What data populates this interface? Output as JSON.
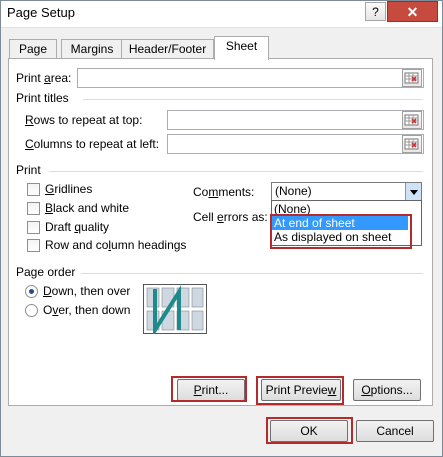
{
  "window": {
    "title": "Page Setup",
    "help": "?",
    "close": "✕"
  },
  "tabs": [
    {
      "label": "Page"
    },
    {
      "label": "Margins"
    },
    {
      "label": "Header/Footer"
    },
    {
      "label": "Sheet"
    }
  ],
  "print_area": {
    "label_pre": "Print ",
    "label_u": "a",
    "label_post": "rea:",
    "value": ""
  },
  "print_titles": {
    "heading": "Print titles",
    "rows": {
      "label_u": "R",
      "label_post": "ows to repeat at top:",
      "value": ""
    },
    "cols": {
      "label_u": "C",
      "label_post": "olumns to repeat at left:",
      "value": ""
    }
  },
  "print": {
    "heading": "Print",
    "gridlines": {
      "label_u": "G",
      "label_post": "ridlines",
      "checked": false
    },
    "bw": {
      "label_u": "B",
      "label_post": "lack and white",
      "checked": false
    },
    "draft": {
      "label_pre": "Draft ",
      "label_u": "q",
      "label_post": "uality",
      "checked": false
    },
    "rowcol": {
      "label_pre": "Row and co",
      "label_u": "l",
      "label_post": "umn headings",
      "checked": false
    },
    "comments": {
      "label_pre": "Co",
      "label_u": "m",
      "label_post": "ments:",
      "value": "(None)"
    },
    "cell_errors": {
      "label_pre": "Cell ",
      "label_u": "e",
      "label_post": "rrors as:"
    },
    "dropdown_options": [
      "(None)",
      "At end of sheet",
      "As displayed on sheet"
    ],
    "highlighted_option": "At end of sheet"
  },
  "page_order": {
    "heading": "Page order",
    "down": {
      "label_u": "D",
      "label_post": "own, then over",
      "selected": true
    },
    "over": {
      "label_pre": "O",
      "label_u": "v",
      "label_post": "er, then down",
      "selected": false
    }
  },
  "buttons": {
    "print": {
      "label_u": "P",
      "label_post": "rint..."
    },
    "preview": {
      "label_pre": "Print Previe",
      "label_u": "w",
      "label_post": ""
    },
    "options": {
      "label_u": "O",
      "label_post": "ptions..."
    },
    "ok": "OK",
    "cancel": "Cancel"
  },
  "colors": {
    "highlight": "#3399ff",
    "annotation": "#b52a2a",
    "close": "#c74a3f"
  }
}
